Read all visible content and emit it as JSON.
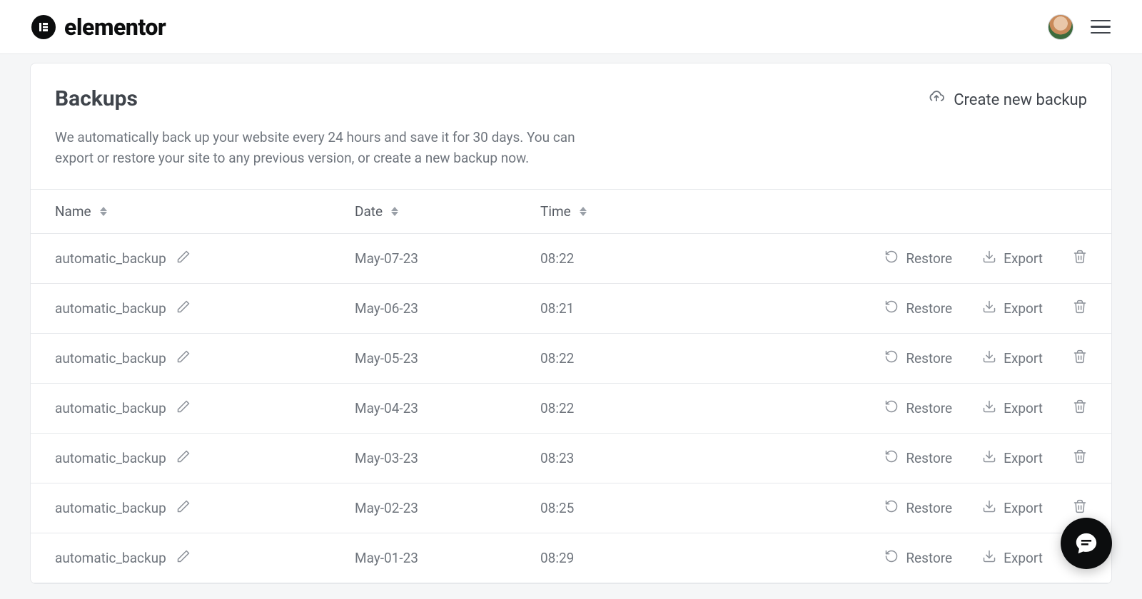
{
  "brand": {
    "name": "elementor"
  },
  "header": {
    "title": "Backups",
    "description": "We automatically back up your website every 24 hours and save it for 30 days. You can export or restore your site to any previous version, or create a new backup now.",
    "create_label": "Create new backup"
  },
  "table": {
    "columns": {
      "name": "Name",
      "date": "Date",
      "time": "Time"
    },
    "actions": {
      "restore": "Restore",
      "export": "Export"
    },
    "rows": [
      {
        "name": "automatic_backup",
        "date": "May-07-23",
        "time": "08:22"
      },
      {
        "name": "automatic_backup",
        "date": "May-06-23",
        "time": "08:21"
      },
      {
        "name": "automatic_backup",
        "date": "May-05-23",
        "time": "08:22"
      },
      {
        "name": "automatic_backup",
        "date": "May-04-23",
        "time": "08:22"
      },
      {
        "name": "automatic_backup",
        "date": "May-03-23",
        "time": "08:23"
      },
      {
        "name": "automatic_backup",
        "date": "May-02-23",
        "time": "08:25"
      },
      {
        "name": "automatic_backup",
        "date": "May-01-23",
        "time": "08:29"
      }
    ]
  }
}
